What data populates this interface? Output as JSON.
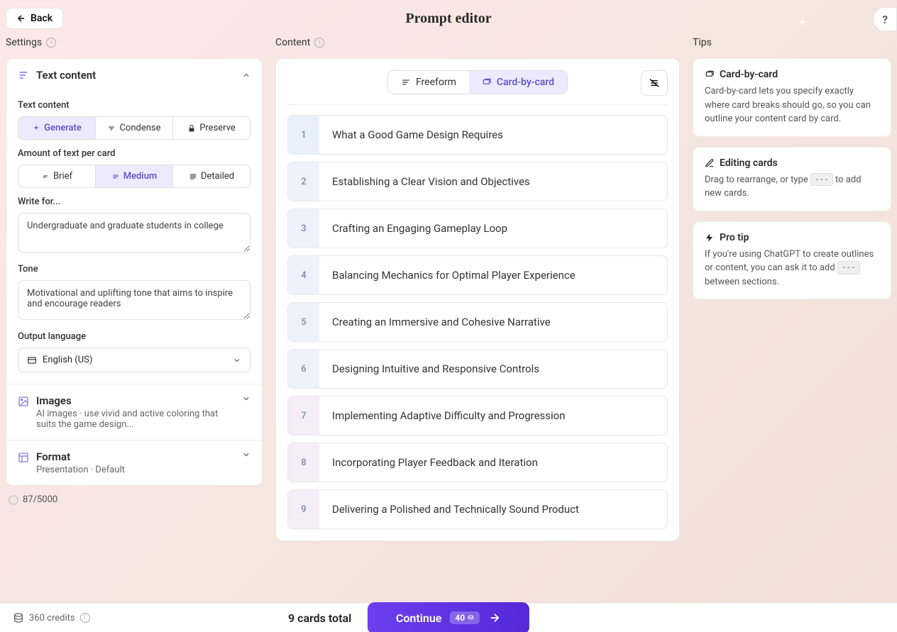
{
  "header": {
    "back_label": "Back",
    "page_title": "Prompt editor",
    "help_label": "?"
  },
  "columns": {
    "settings_label": "Settings",
    "content_label": "Content",
    "tips_label": "Tips"
  },
  "settings": {
    "text_content": {
      "section_title": "Text content",
      "field_label": "Text content",
      "actions": {
        "generate": "Generate",
        "condense": "Condense",
        "preserve": "Preserve"
      },
      "amount_label": "Amount of text per card",
      "amounts": {
        "brief": "Brief",
        "medium": "Medium",
        "detailed": "Detailed"
      },
      "write_for_label": "Write for...",
      "write_for_value": "Undergraduate and graduate students in college",
      "tone_label": "Tone",
      "tone_value": "Motivational and uplifting tone that aims to inspire and encourage readers",
      "lang_label": "Output language",
      "lang_value": "English (US)"
    },
    "images": {
      "title": "Images",
      "sub": "AI images · use vivid and active coloring that suits the game design..."
    },
    "format": {
      "title": "Format",
      "sub": "Presentation · Default"
    },
    "counter": "87/5000"
  },
  "content": {
    "tabs": {
      "freeform": "Freeform",
      "card_by_card": "Card-by-card"
    },
    "cards": [
      {
        "n": "1",
        "text": "What a Good Game Design Requires"
      },
      {
        "n": "2",
        "text": "Establishing a Clear Vision and Objectives"
      },
      {
        "n": "3",
        "text": "Crafting an Engaging Gameplay Loop"
      },
      {
        "n": "4",
        "text": "Balancing Mechanics for Optimal Player Experience"
      },
      {
        "n": "5",
        "text": "Creating an Immersive and Cohesive Narrative"
      },
      {
        "n": "6",
        "text": "Designing Intuitive and Responsive Controls"
      },
      {
        "n": "7",
        "text": "Implementing Adaptive Difficulty and Progression"
      },
      {
        "n": "8",
        "text": "Incorporating Player Feedback and Iteration"
      },
      {
        "n": "9",
        "text": "Delivering a Polished and Technically Sound Product"
      }
    ]
  },
  "tips": [
    {
      "icon": "cards",
      "title": "Card-by-card",
      "body": "Card-by-card lets you specify exactly where card breaks should go, so you can outline your content card by card."
    },
    {
      "icon": "edit",
      "title": "Editing cards",
      "body_pre": "Drag to rearrange, or type ",
      "kbd": "---",
      "body_post": " to add new cards."
    },
    {
      "icon": "bolt",
      "title": "Pro tip",
      "body_pre": "If you're using ChatGPT to create outlines or content, you can ask it to add ",
      "kbd": "---",
      "body_post": " between sections."
    }
  ],
  "footer": {
    "credits": "360 credits",
    "cards_total": "9 cards total",
    "continue": "Continue",
    "cost": "40"
  }
}
